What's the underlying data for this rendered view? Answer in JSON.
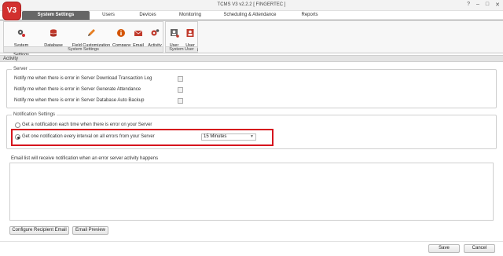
{
  "window": {
    "title": "TCMS V3 v2.2.2 [ FINGERTEC ]",
    "logo_text": "V3",
    "controls": [
      "?",
      "–",
      "□",
      "✕"
    ]
  },
  "tabs": [
    {
      "label": "System Settings",
      "active": true
    },
    {
      "label": "Users",
      "active": false
    },
    {
      "label": "Devices",
      "active": false
    },
    {
      "label": "Monitoring",
      "active": false
    },
    {
      "label": "Scheduling & Attendance",
      "active": false
    },
    {
      "label": "Reports",
      "active": false
    }
  ],
  "ribbon": {
    "system_settings_group": {
      "label": "System Settings",
      "buttons": [
        {
          "label": "System Parameter\nSettings",
          "icon": "gears-icon"
        },
        {
          "label": "Database\nConfiguration",
          "icon": "database-icon"
        },
        {
          "label": "Field Customization\nManagement",
          "icon": "pencil-icon"
        },
        {
          "label": "Company\nInfo",
          "icon": "info-icon"
        },
        {
          "label": "Email",
          "icon": "envelope-icon"
        },
        {
          "label": "Activity",
          "icon": "activity-gear-icon"
        }
      ]
    },
    "system_user_group": {
      "label": "System User",
      "buttons": [
        {
          "label": "User\nRoles",
          "icon": "user-roles-icon"
        },
        {
          "label": "User\nAccount",
          "icon": "user-account-icon"
        }
      ]
    }
  },
  "activity_bar": {
    "title": "Activity"
  },
  "server_section": {
    "legend": "Server",
    "options": [
      {
        "label": "Notify me when there is error in Server Download Transaction Log",
        "checked": false
      },
      {
        "label": "Notify me when there is error in Server Generate Attendance",
        "checked": false
      },
      {
        "label": "Notify me when there is error in Server Database Auto Backup",
        "checked": false
      }
    ]
  },
  "notification_section": {
    "legend": "Notification Settings",
    "option_each": "Get a notification each time when there is error on your Server",
    "option_interval": "Get one notification every interval on all errors from your Server",
    "selected": "interval",
    "interval_value": "15 Minutes"
  },
  "email_list": {
    "caption": "Email list will receive notification when an error server activity happens"
  },
  "buttons": {
    "configure": "Configure Recipient Email",
    "preview": "Email Preview",
    "save": "Save",
    "cancel": "Cancel"
  },
  "colors": {
    "highlight": "#d6141d",
    "active_tab": "#666666",
    "logo": "#d2302f"
  }
}
